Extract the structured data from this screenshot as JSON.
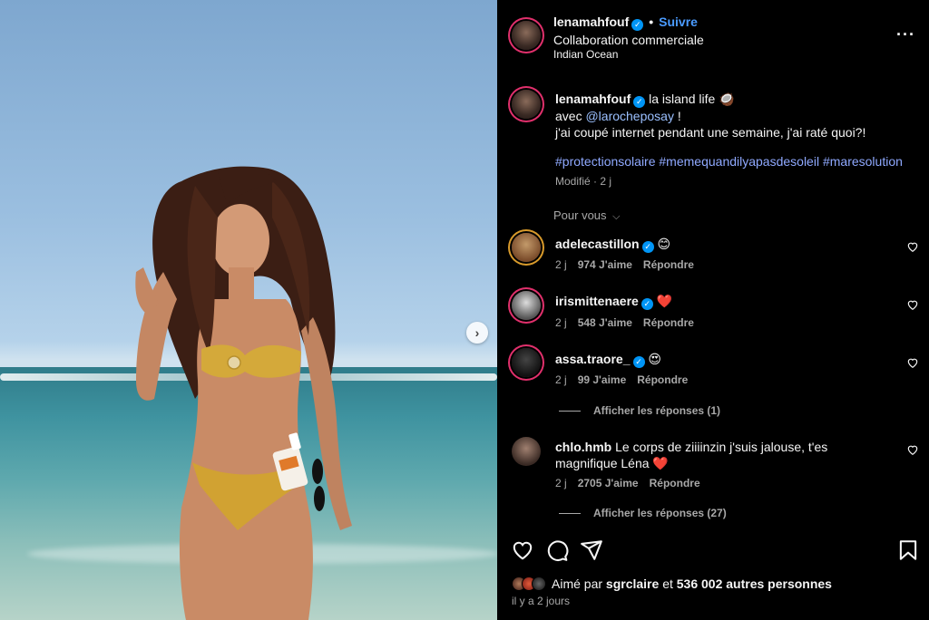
{
  "post": {
    "username": "lenamahfouf",
    "follow_label": "Suivre",
    "sponsor_label": "Collaboration commerciale",
    "location": "Indian Ocean",
    "caption_text": "la island life 🥥",
    "caption_with": "avec",
    "caption_mention": "@larocheposay",
    "caption_mention_end": "!",
    "caption_line2": "j'ai coupé internet pendant une semaine, j'ai raté quoi?!",
    "hashtags": "#protectionsolaire #memequandilyapasdesoleil #maresolution",
    "edited_meta": "Modifié · 2 j",
    "for_you_label": "Pour vous",
    "more_icon": "more-horizontal-icon"
  },
  "comments": [
    {
      "user": "adelecastillon",
      "text": "😊",
      "age": "2 j",
      "likes": "974 J'aime",
      "reply": "Répondre"
    },
    {
      "user": "irismittenaere",
      "text": "❤️",
      "age": "2 j",
      "likes": "548 J'aime",
      "reply": "Répondre"
    },
    {
      "user": "assa.traore_",
      "text": "😍",
      "age": "2 j",
      "likes": "99 J'aime",
      "reply": "Répondre",
      "replies": "Afficher les réponses (1)"
    },
    {
      "user": "chlo.hmb",
      "text": "Le corps de ziiiinzin j'suis jalouse, t'es magnifique Léna ❤️",
      "age": "2 j",
      "likes": "2705 J'aime",
      "reply": "Répondre",
      "replies": "Afficher les réponses (27)"
    }
  ],
  "footer": {
    "liked_by_prefix": "Aimé par",
    "liked_by_user": "sgrclaire",
    "liked_by_and": "et",
    "liked_by_count": "536 002 autres personnes",
    "time_ago": "il y a 2 jours"
  },
  "colors": {
    "verified": "#0095f6",
    "follow": "#4a9bff",
    "hashtag": "#8fa9ff",
    "background": "#000000"
  }
}
